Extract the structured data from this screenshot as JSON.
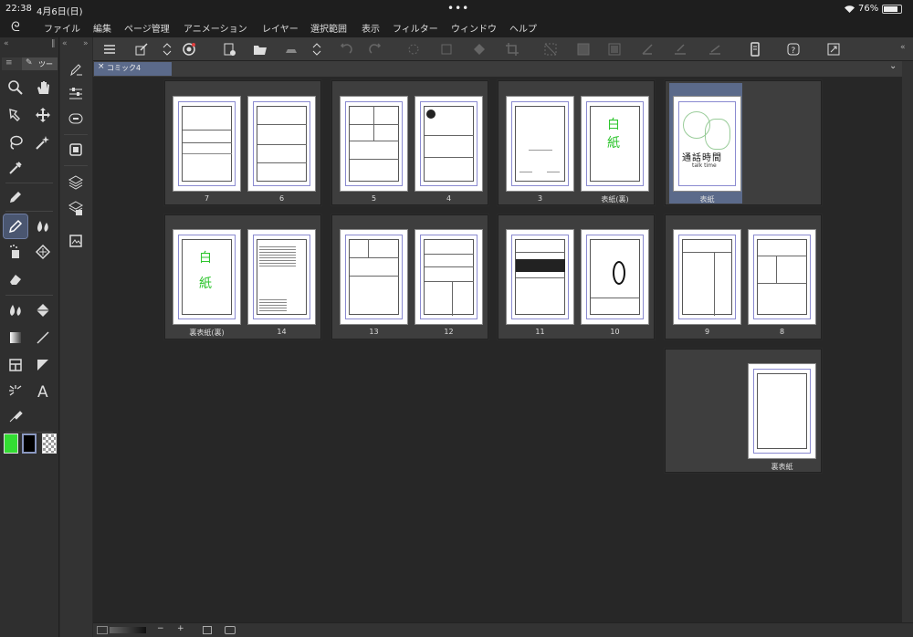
{
  "status": {
    "time": "22:38",
    "date": "4月6日(日)",
    "wifi_icon": "wifi-icon",
    "battery": "76%"
  },
  "menu": [
    "ファイル",
    "編集",
    "ページ管理",
    "アニメーション",
    "レイヤー",
    "選択範囲",
    "表示",
    "フィルター",
    "ウィンドウ",
    "ヘルプ"
  ],
  "tools_header": "ツー",
  "document_tab": "コミック4",
  "pages": {
    "p7": "7",
    "p6": "6",
    "p5": "5",
    "p4": "4",
    "p3": "3",
    "cover_back": "表紙(裏)",
    "cover": "表紙",
    "back_cover_back": "裏表紙(裏)",
    "p14": "14",
    "p13": "13",
    "p12": "12",
    "p11": "11",
    "p10": "10",
    "p9": "9",
    "p8": "8",
    "back_cover": "裏表紙"
  },
  "page_text": {
    "blank_1": "白",
    "blank_2": "紙",
    "cover_title": "通話時間",
    "cover_subtitle": "talk time"
  },
  "bottom": {
    "minus": "−",
    "plus": "+"
  },
  "colors": {
    "main": "#33dd33",
    "sub": "#000000",
    "accent": "#5b6a8a"
  }
}
